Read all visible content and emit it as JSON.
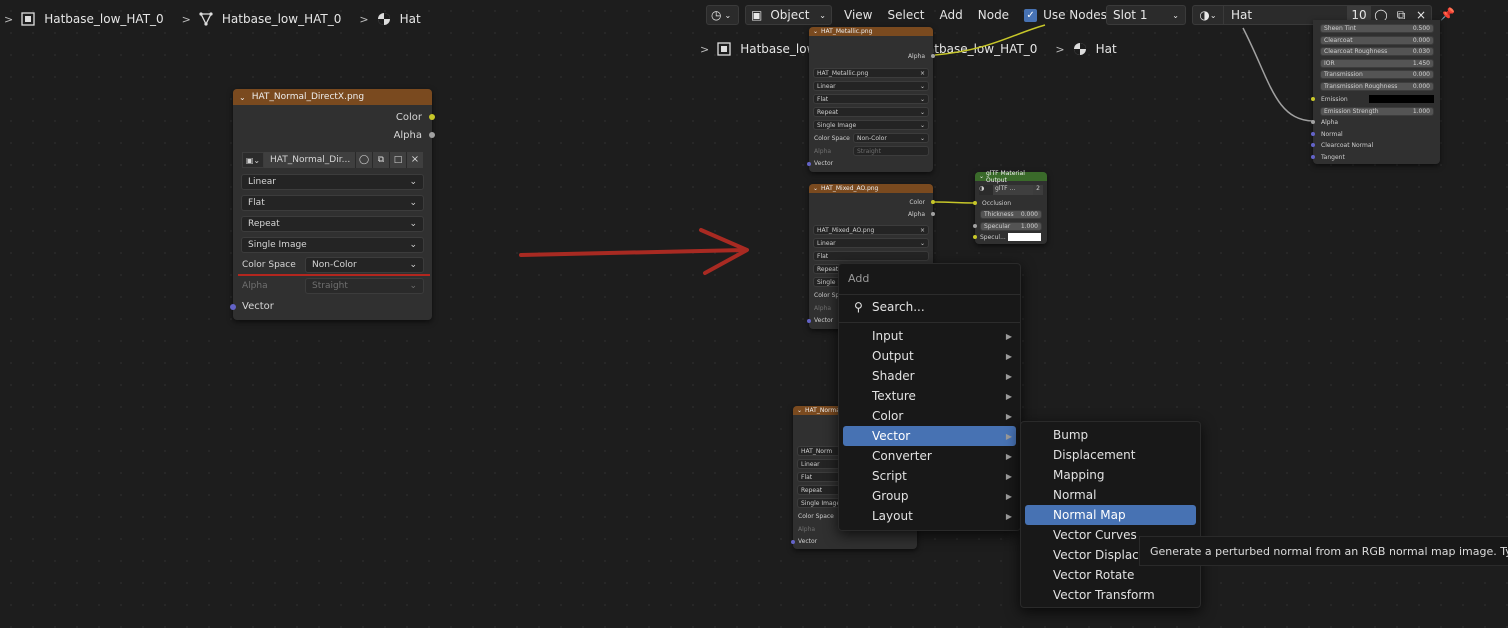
{
  "breadcrumb_left": {
    "object": "Hatbase_low_HAT_0",
    "mesh": "Hatbase_low_HAT_0",
    "material": "Hat"
  },
  "breadcrumb_right": {
    "object": "Hatbase_low_HAT_0",
    "mesh": "Hatbase_low_HAT_0",
    "material": "Hat"
  },
  "header": {
    "mode": "Object",
    "menus": [
      "View",
      "Select",
      "Add",
      "Node"
    ],
    "use_nodes_label": "Use Nodes",
    "use_nodes_checked": true,
    "slot": "Slot 1",
    "material_name": "Hat",
    "user_count": "10"
  },
  "big_node": {
    "title": "HAT_Normal_DirectX.png",
    "out_color": "Color",
    "out_alpha": "Alpha",
    "image_name": "HAT_Normal_Dir...",
    "interpolation": "Linear",
    "projection": "Flat",
    "extension": "Repeat",
    "source": "Single Image",
    "color_space_label": "Color Space",
    "color_space": "Non-Color",
    "alpha_label": "Alpha",
    "alpha_mode": "Straight",
    "in_vector": "Vector"
  },
  "node_metallic": {
    "title": "HAT_Metallic.png",
    "out_alpha": "Alpha",
    "image_name": "HAT_Metallic.png",
    "interpolation": "Linear",
    "projection": "Flat",
    "extension": "Repeat",
    "source": "Single Image",
    "color_space_label": "Color Space",
    "color_space": "Non-Color",
    "alpha_label": "Alpha",
    "alpha_mode": "Straight",
    "in_vector": "Vector"
  },
  "node_ao": {
    "title": "HAT_Mixed_AO.png",
    "out_color": "Color",
    "out_alpha": "Alpha",
    "image_name": "HAT_Mixed_AO.png",
    "interpolation": "Linear",
    "projection": "Flat",
    "extension": "Repeat",
    "source": "Single Im",
    "color_space_label": "Color Space",
    "alpha_label": "Alpha",
    "in_vector": "Vector"
  },
  "node_normal_small": {
    "title": "HAT_Normal",
    "image_name": "HAT_Norm",
    "interpolation": "Linear",
    "projection": "Flat",
    "extension": "Repeat",
    "source": "Single Image",
    "color_space_label": "Color Space",
    "alpha_label": "Alpha",
    "in_vector": "Vector"
  },
  "gltf_node": {
    "title": "glTF Material Output",
    "group_name": "glTF ...",
    "users": "2",
    "occlusion": "Occlusion",
    "thickness_label": "Thickness",
    "thickness_value": "0.000",
    "specular_label": "Specular",
    "specular_value": "1.000",
    "specular_color_label": "Specul..."
  },
  "bsdf_node": {
    "rows": [
      {
        "label": "Sheen Tint",
        "value": "0.500"
      },
      {
        "label": "Clearcoat",
        "value": "0.000"
      },
      {
        "label": "Clearcoat Roughness",
        "value": "0.030"
      },
      {
        "label": "IOR",
        "value": "1.450"
      },
      {
        "label": "Transmission",
        "value": "0.000"
      },
      {
        "label": "Transmission Roughness",
        "value": "0.000"
      }
    ],
    "emission": "Emission",
    "emission_strength_label": "Emission Strength",
    "emission_strength_value": "1.000",
    "inputs": [
      "Alpha",
      "Normal",
      "Clearcoat Normal",
      "Tangent"
    ]
  },
  "add_menu": {
    "title": "Add",
    "search": "Search...",
    "items": [
      "Input",
      "Output",
      "Shader",
      "Texture",
      "Color",
      "Vector",
      "Converter",
      "Script",
      "Group",
      "Layout"
    ],
    "selected": "Vector"
  },
  "vector_submenu": {
    "items": [
      "Bump",
      "Displacement",
      "Mapping",
      "Normal",
      "Normal Map",
      "Vector Curves",
      "Vector Displacement",
      "Vector Rotate",
      "Vector Transform"
    ],
    "selected": "Normal Map"
  },
  "tooltip": "Generate a perturbed normal from an RGB normal map image. Typically",
  "colors": {
    "accent": "#4772b3",
    "node_header": "#7a4a1f",
    "gltf_header": "#3a6a2a",
    "arrow": "#a82a22",
    "socket_yellow": "#c7c729",
    "socket_grey": "#a1a1a1",
    "socket_purple": "#6363c7"
  }
}
